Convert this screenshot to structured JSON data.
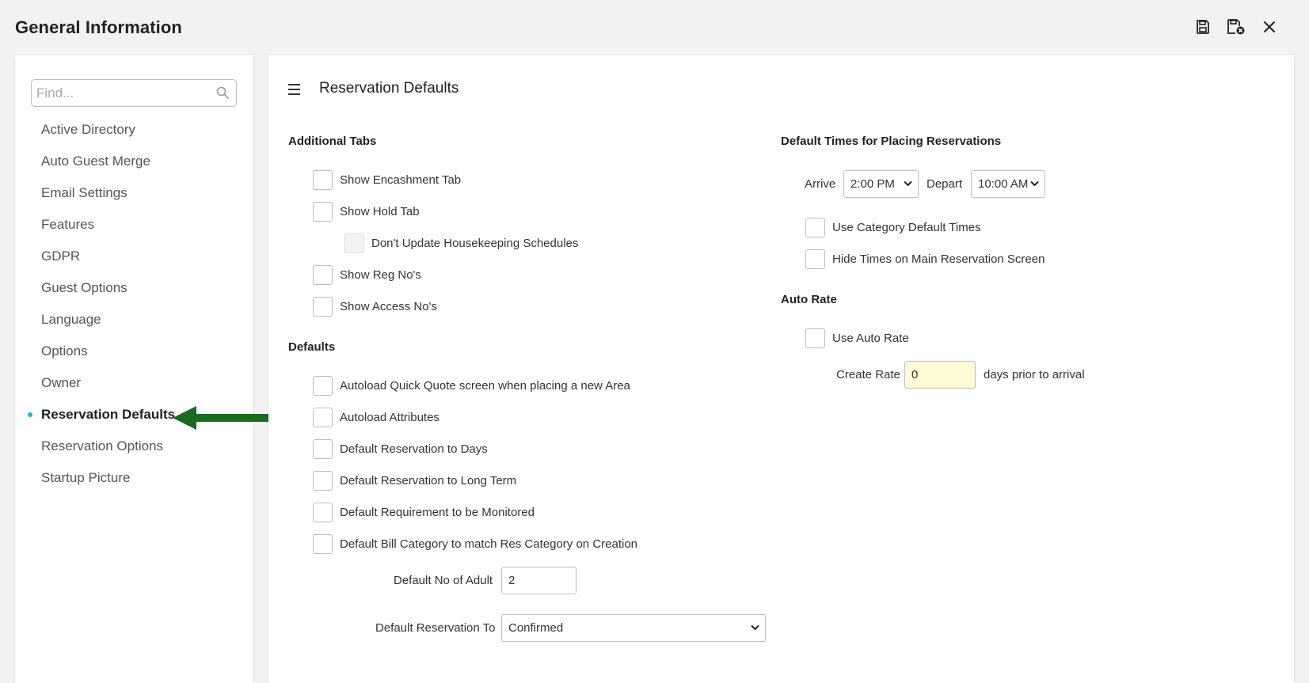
{
  "window": {
    "title": "General Information",
    "actions": {
      "save_icon": "save-icon",
      "save_close_icon": "save-close-icon",
      "close_icon": "close-icon"
    }
  },
  "sidebar": {
    "search_placeholder": "Find...",
    "items": [
      {
        "label": "Active Directory",
        "active": false
      },
      {
        "label": "Auto Guest Merge",
        "active": false
      },
      {
        "label": "Email Settings",
        "active": false
      },
      {
        "label": "Features",
        "active": false
      },
      {
        "label": "GDPR",
        "active": false
      },
      {
        "label": "Guest Options",
        "active": false
      },
      {
        "label": "Language",
        "active": false
      },
      {
        "label": "Options",
        "active": false
      },
      {
        "label": "Owner",
        "active": false
      },
      {
        "label": "Reservation Defaults",
        "active": true
      },
      {
        "label": "Reservation Options",
        "active": false
      },
      {
        "label": "Startup Picture",
        "active": false
      }
    ],
    "active_dot_color": "#19b6c9",
    "annotation_arrow_color": "#1a6b1f"
  },
  "main": {
    "title": "Reservation Defaults",
    "additional_tabs": {
      "title": "Additional Tabs",
      "show_encashment": "Show Encashment Tab",
      "show_hold": "Show Hold Tab",
      "dont_update_housekeeping": "Don't Update Housekeeping Schedules",
      "show_reg_nos": "Show Reg No's",
      "show_access_nos": "Show Access No's"
    },
    "defaults": {
      "title": "Defaults",
      "autoload_quick_quote": "Autoload Quick Quote screen when placing a new Area",
      "autoload_attributes": "Autoload Attributes",
      "default_res_days": "Default Reservation to Days",
      "default_res_long_term": "Default Reservation to Long Term",
      "default_req_monitored": "Default Requirement to be Monitored",
      "default_bill_category": "Default Bill Category to match Res Category on Creation",
      "default_no_adult_label": "Default No of Adult",
      "default_no_adult_value": "2",
      "default_res_to_label": "Default Reservation To",
      "default_res_to_value": "Confirmed"
    },
    "default_times": {
      "title": "Default Times for Placing Reservations",
      "arrive_label": "Arrive",
      "arrive_value": "2:00 PM",
      "depart_label": "Depart",
      "depart_value": "10:00 AM",
      "use_category_default_times": "Use Category Default Times",
      "hide_times": "Hide Times on Main Reservation Screen"
    },
    "auto_rate": {
      "title": "Auto Rate",
      "use_auto_rate": "Use Auto Rate",
      "create_rate_label": "Create Rate",
      "create_rate_value": "0",
      "days_prior_label": "days prior to arrival"
    }
  }
}
